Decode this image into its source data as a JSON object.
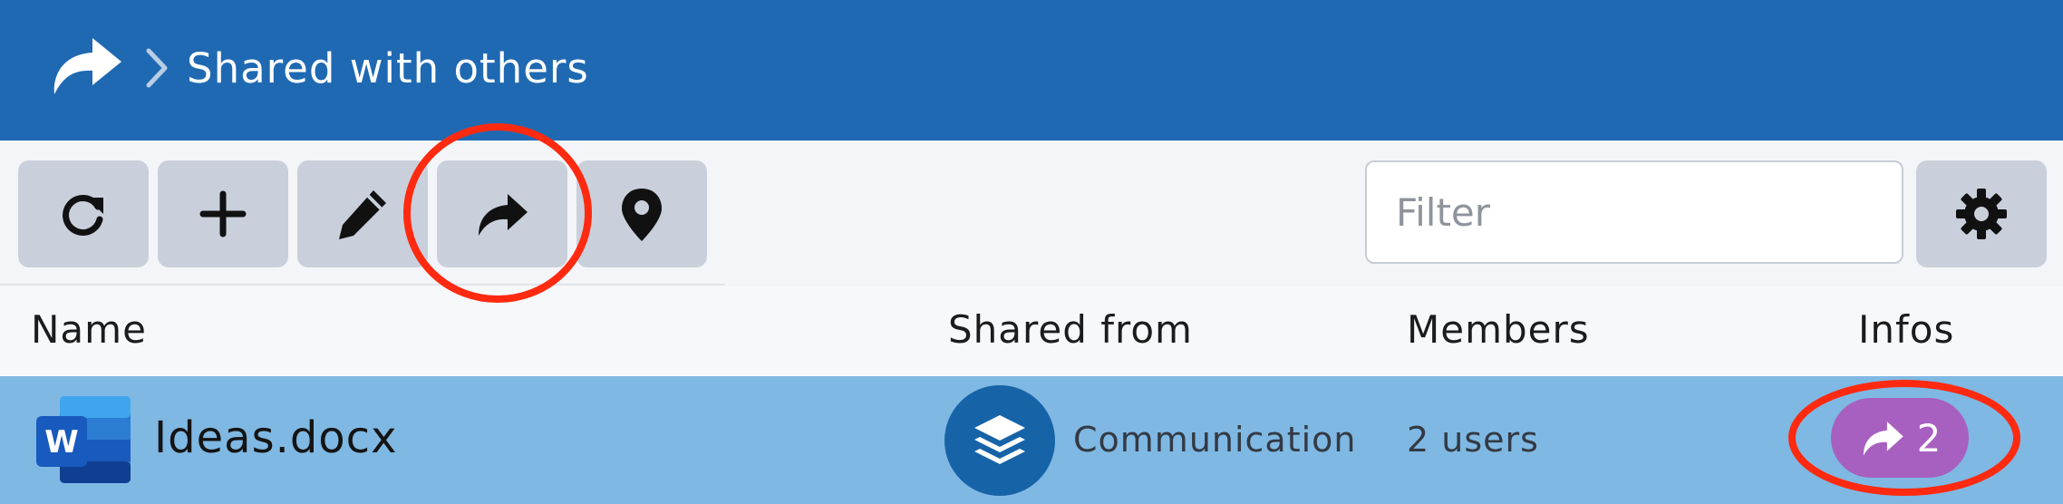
{
  "header": {
    "title": "Shared with others",
    "home_icon": "share-icon",
    "separator_icon": "chevron-right-icon",
    "background": "#1f69b2"
  },
  "toolbar": {
    "buttons": [
      {
        "icon": "refresh-icon"
      },
      {
        "icon": "plus-icon"
      },
      {
        "icon": "pencil-icon"
      },
      {
        "icon": "share-icon"
      },
      {
        "icon": "map-pin-icon"
      }
    ],
    "filter_placeholder": "Filter",
    "settings_icon": "gear-icon"
  },
  "columns": {
    "name": "Name",
    "shared_from": "Shared from",
    "members": "Members",
    "infos": "Infos"
  },
  "rows": [
    {
      "file_icon": "word-file-icon",
      "file_icon_letter": "W",
      "name": "Ideas.docx",
      "shared_from_icon": "layers-icon",
      "shared_from": "Communication",
      "members": "2 users",
      "infos_icon": "share-icon",
      "infos_count": "2"
    }
  ],
  "colors": {
    "row_selected": "#7fb8e3",
    "badge": "#a760c0",
    "annotation": "#ff2a10"
  }
}
